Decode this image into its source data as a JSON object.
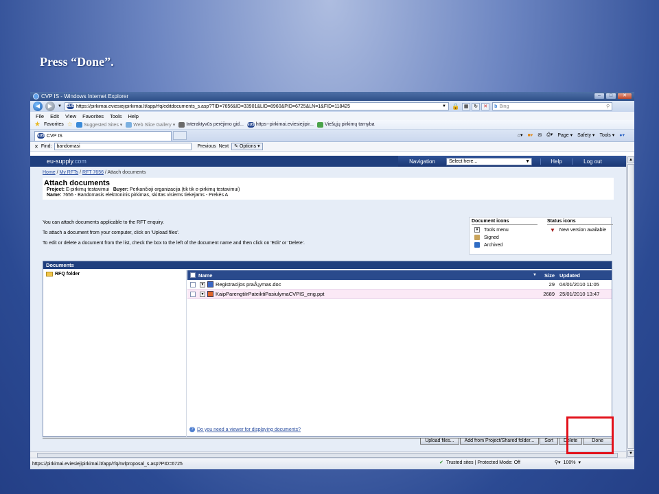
{
  "caption": "Press “Done”.",
  "window": {
    "title": "CVP IS - Windows Internet Explorer",
    "url": "https://pirkimai.eviesiejipirkimai.lt/app/rfq/editdocuments_s.asp?TID=7656&ID=33901&LID=8960&PID=6725&LN=1&FID=118425",
    "url_host": "pirkimai.eviesiejipirkimai.lt",
    "search_provider": "Bing",
    "favicon_text": "EUS"
  },
  "menu": [
    "File",
    "Edit",
    "View",
    "Favorites",
    "Tools",
    "Help"
  ],
  "favorites": {
    "label": "Favorites",
    "items": [
      "Suggested Sites ▾",
      "Web Slice Gallery ▾",
      "Interaktyvūs perėjimo gid...",
      "https--pirkimai.eviesiejipir...",
      "Viešųjų pirkimų tarnyba"
    ]
  },
  "tab": {
    "label": "CVP IS"
  },
  "command_bar": [
    "Page ▾",
    "Safety ▾",
    "Tools ▾"
  ],
  "find": {
    "label": "Find:",
    "value": "bandomasi",
    "previous": "Previous",
    "next": "Next",
    "options": "Options"
  },
  "site": {
    "logo_main": "eu-supply",
    "logo_suffix": ".com",
    "nav_label": "Navigation",
    "nav_select": "Select here...",
    "help": "Help",
    "logout": "Log out"
  },
  "breadcrumb": {
    "home": "Home",
    "my_rfts": "My RFTs",
    "rft": "RFT  7656",
    "current": "Attach documents"
  },
  "page": {
    "title": "Attach documents",
    "project_label": "Project:",
    "project_value": "E-pirkimų testavimui",
    "buyer_label": "Buyer:",
    "buyer_value": "Perkančioji organizacija (tik tik e-pirkimų testavimui)",
    "name_label": "Name:",
    "name_value": "7656 - Bandomasis elektroninis pirkimas, skirtas visiems tiekejams - Prekės A"
  },
  "instructions": [
    "You can attach documents applicable to the RFT enquiry.",
    "To attach a document from your computer, click on 'Upload files'.",
    "To edit or delete a document from the list, check the box to the left of the document name and then click on 'Edit' or 'Delete'."
  ],
  "legend": {
    "doc_icons_title": "Document icons",
    "doc_icons": [
      "Tools menu",
      "Signed",
      "Archived"
    ],
    "status_icons_title": "Status icons",
    "status_icons": [
      "New version available"
    ]
  },
  "documents": {
    "header": "Documents",
    "folder": "RFQ folder",
    "columns": {
      "name": "Name",
      "size": "Size",
      "updated": "Updated"
    },
    "rows": [
      {
        "name": "Registracijos praÅ¡ymas.doc",
        "size": "29",
        "updated": "04/01/2010 11:05"
      },
      {
        "name": "KaipParengtiIrPateiktiPasiulymaCVPIS_eng.ppt",
        "size": "2689",
        "updated": "25/01/2010 13:47"
      }
    ],
    "viewer_link": "Do you need a viewer for displaying documents?"
  },
  "actions": [
    "Upload files...",
    "Add from Project/Shared folder...",
    "Sort",
    "Delete",
    "Done"
  ],
  "status": {
    "url": "https://pirkimai.eviesiejipirkimai.lt/app/rfq/rwlproposal_s.asp?PID=6725",
    "zone": "Trusted sites | Protected Mode: Off",
    "zoom": "100%"
  },
  "colors": {
    "site_header": "#1f3f7e",
    "highlight": "#e2111b",
    "row_pink": "#fbe9f6"
  }
}
